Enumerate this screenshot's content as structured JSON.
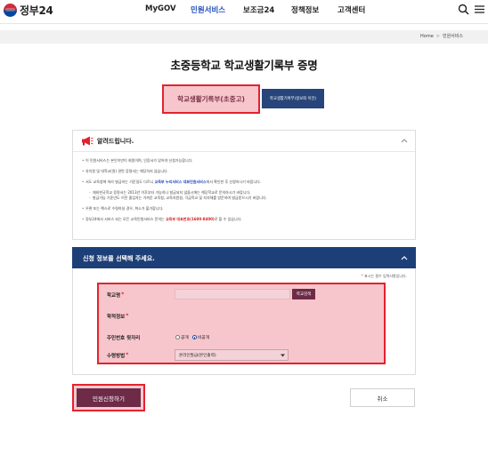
{
  "header": {
    "logo_text": "정부24",
    "nav": [
      {
        "label": "MyGOV",
        "active": false
      },
      {
        "label": "민원서비스",
        "active": true
      },
      {
        "label": "보조금24",
        "active": false
      },
      {
        "label": "정책정보",
        "active": false
      },
      {
        "label": "고객센터",
        "active": false
      }
    ],
    "icons": [
      "search-icon",
      "menu-icon"
    ]
  },
  "breadcrumb": {
    "home": "Home",
    "current": "민원서비스",
    "separator": ">"
  },
  "page_title": "초중등학교 학교생활기록부 증명",
  "tabs": [
    {
      "label": "학교생활기록부(초중고)",
      "selected": true
    },
    {
      "label": "학교생활기록부(정보화 이전)",
      "selected": false
    }
  ],
  "notice": {
    "title": "알려드립니다.",
    "icon": "megaphone-icon",
    "items": [
      {
        "type": "main",
        "parts": [
          {
            "text": "이 민원서비스는 본인이만이 회원이며, "
          },
          {
            "text": "인증서",
            "style": "bold"
          },
          {
            "text": "가 있어야 신청가능합니다."
          }
        ]
      },
      {
        "type": "main",
        "parts": [
          {
            "text": "유치원 및 대학교(원) 관련 증명서는 해당하지 않습니다."
          }
        ]
      },
      {
        "type": "main",
        "parts": [
          {
            "text": "서도 교육청에 따라 발급하는 기준일도 다르니 "
          },
          {
            "text": "교육부 누리서비스 대표민원서비스",
            "style": "blue"
          },
          {
            "text": "에서 확인한 후 신청하시기 바랍니다."
          }
        ]
      },
      {
        "type": "sub",
        "parts": [
          {
            "text": "재외한국학교 증명서는 2013년 이후부터 가능하나 발급되지 않을시에는 해당학교로 문의하시기 바랍니다."
          }
        ]
      },
      {
        "type": "sub",
        "last": true,
        "parts": [
          {
            "text": "발급가능 기준년도 이전 졸업자는 가까운 교육청, 교육지원청, 각급학교 및 지자체를 방문하여 발급받으시기 바랍니다."
          }
        ]
      },
      {
        "type": "main",
        "parts": [
          {
            "text": "우편 또는 팩스로 수령하실 경우, 취소가 불가합니다."
          }
        ]
      },
      {
        "type": "main",
        "parts": [
          {
            "text": "정부24에서 서비스 되는 모든 교육민원서비스 문의는 "
          },
          {
            "text": "교육부 대표번호(1600-8400)",
            "style": "red"
          },
          {
            "text": "로 할 수 있습니다."
          }
        ]
      }
    ]
  },
  "form": {
    "header": "신청 정보를 선택해 주세요.",
    "required_note": "표시는 필수 입력사항입니다.",
    "required_mark": "*",
    "fields": {
      "school_name": {
        "label": "학교명",
        "required": true,
        "value": "",
        "button": "학교검색"
      },
      "academic_info": {
        "label": "학적정보",
        "required": true
      },
      "rrn_disclosure": {
        "label": "주민번호 뒷자리",
        "options": [
          "공개",
          "비공개"
        ],
        "selected": "비공개"
      },
      "receive_method": {
        "label": "수령방법",
        "required": true,
        "value": "온라인발급(본인출력)"
      }
    }
  },
  "buttons": {
    "apply": "민원신청하기",
    "cancel": "취소"
  },
  "colors": {
    "nav_active": "#1f4fb7",
    "form_header_bg": "#1d3f77",
    "primary_button": "#6d2b47",
    "highlight_border": "#e2232f",
    "highlight_fill": "#f7c6cc"
  }
}
